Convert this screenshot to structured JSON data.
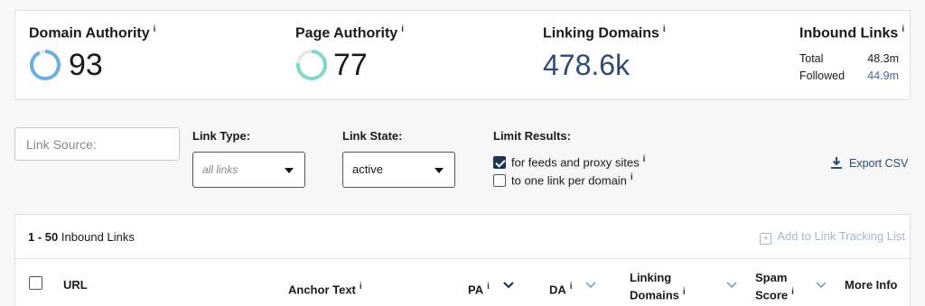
{
  "metrics": {
    "domain_authority": {
      "label": "Domain Authority",
      "info": "i",
      "value": "93",
      "progress": 0.93,
      "color": "#6ab0e0"
    },
    "page_authority": {
      "label": "Page Authority",
      "info": "i",
      "value": "77",
      "progress": 0.77,
      "color": "#7fd8c8"
    },
    "linking_domains": {
      "label": "Linking Domains",
      "info": "i",
      "value": "478.6k"
    },
    "inbound_links": {
      "label": "Inbound Links",
      "info": "i",
      "total_label": "Total",
      "total_value": "48.3m",
      "followed_label": "Followed",
      "followed_value": "44.9m"
    }
  },
  "filters": {
    "link_source_placeholder": "Link Source:",
    "link_type": {
      "label": "Link Type:",
      "value": "all links"
    },
    "link_state": {
      "label": "Link State:",
      "value": "active"
    },
    "limit_results": {
      "label": "Limit Results:",
      "option1": {
        "label": "for feeds and proxy sites",
        "info": "i",
        "checked": true
      },
      "option2": {
        "label": "to one link per domain",
        "info": "i",
        "checked": false
      }
    },
    "export_label": "Export CSV"
  },
  "table": {
    "range": "1 - 50",
    "range_suffix": "Inbound Links",
    "add_tracking": "Add to Link Tracking List",
    "columns": {
      "url": "URL",
      "anchor": "Anchor Text",
      "pa": "PA",
      "da": "DA",
      "linking_line1": "Linking",
      "linking_line2": "Domains",
      "spam_line1": "Spam",
      "spam_line2": "Score",
      "more": "More Info",
      "info": "i"
    }
  },
  "colors": {
    "accent": "#2f4a73",
    "checkbox": "#1e3550",
    "muted": "#a8b6c8"
  }
}
